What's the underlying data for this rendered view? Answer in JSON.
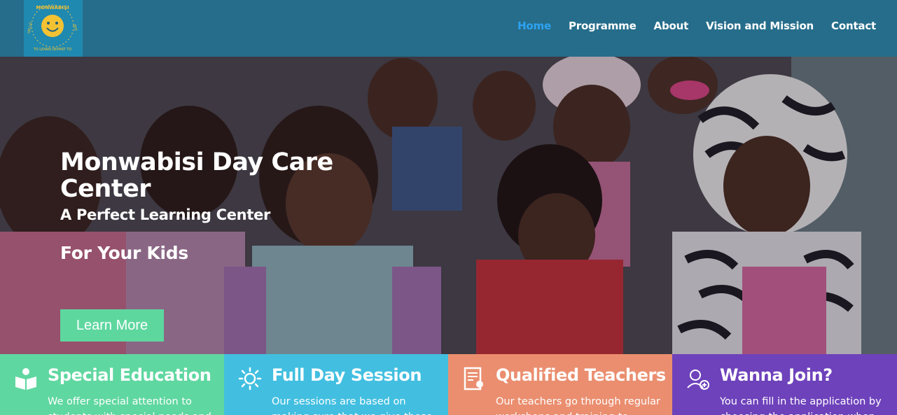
{
  "navbar": {
    "logo": {
      "text_top": "MONWABISI",
      "text_left": "HELLO",
      "text_right": "BYE",
      "text_bottom": "TO LEARN DEPART TO"
    },
    "links": [
      {
        "label": "Home",
        "active": true
      },
      {
        "label": "Programme",
        "active": false
      },
      {
        "label": "About",
        "active": false
      },
      {
        "label": "Vision and Mission",
        "active": false
      },
      {
        "label": "Contact",
        "active": false
      }
    ],
    "colors": {
      "bar": "#266d8b",
      "logo_bg": "#1f89b0",
      "active_link": "#2ea3f2"
    }
  },
  "hero": {
    "title": "Monwabisi Day Care Center",
    "subtitle": "A Perfect Learning Center",
    "subtitle2": "For Your Kids",
    "button_label": "Learn More",
    "button_color": "#5ed79f",
    "image": "photo of a group of young children"
  },
  "features": [
    {
      "title": "Special Education",
      "description": "We offer special attention to students with special needs and",
      "icon": "book-reader-icon",
      "color": "#5fd7a0"
    },
    {
      "title": "Full Day Session",
      "description": "Our sessions are based on making sure that we give these",
      "icon": "sun-icon",
      "color": "#42bfe0"
    },
    {
      "title": "Qualified Teachers",
      "description": "Our teachers go through regular workshops and training to",
      "icon": "certificate-icon",
      "color": "#ea8e6f"
    },
    {
      "title": "Wanna Join?",
      "description": "You can fill in the application by choosing the application when",
      "icon": "add-user-icon",
      "color": "#6e42bb"
    }
  ]
}
